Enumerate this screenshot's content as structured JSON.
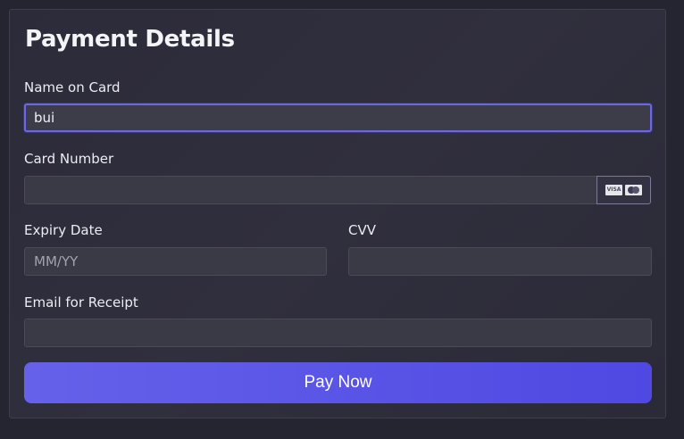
{
  "form": {
    "title": "Payment Details",
    "name": {
      "label": "Name on Card",
      "value": "bui"
    },
    "card_number": {
      "label": "Card Number",
      "value": "",
      "icons": [
        "visa-icon",
        "mastercard-icon"
      ],
      "visa_text": "VISA"
    },
    "expiry": {
      "label": "Expiry Date",
      "placeholder": "MM/YY",
      "value": ""
    },
    "cvv": {
      "label": "CVV",
      "value": ""
    },
    "email": {
      "label": "Email for Receipt",
      "value": ""
    },
    "submit_label": "Pay Now"
  },
  "colors": {
    "accent": "#5a55e6",
    "background": "#252431",
    "field_bg": "#3a3946",
    "focus_border": "#6b67e6"
  }
}
